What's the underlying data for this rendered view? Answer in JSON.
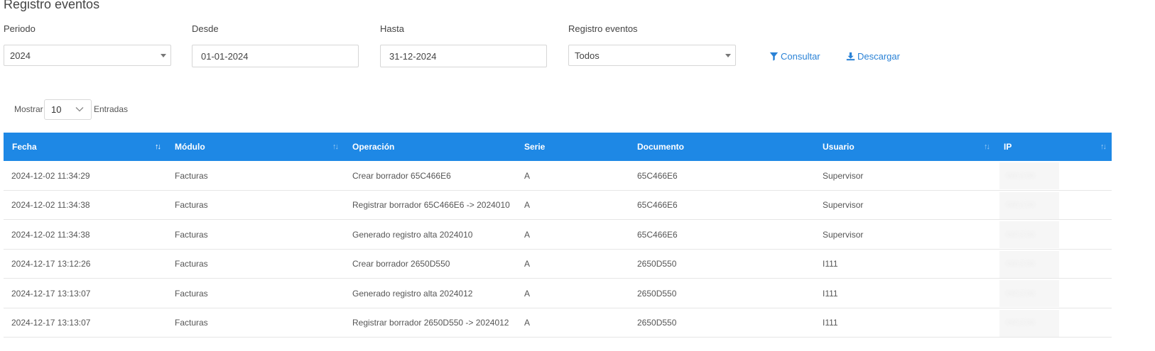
{
  "page": {
    "title": "Registro eventos"
  },
  "filters": {
    "periodo": {
      "label": "Periodo",
      "value": "2024"
    },
    "desde": {
      "label": "Desde",
      "value": "01-01-2024"
    },
    "hasta": {
      "label": "Hasta",
      "value": "31-12-2024"
    },
    "registro": {
      "label": "Registro eventos",
      "value": "Todos"
    }
  },
  "actions": {
    "consultar": {
      "label": "Consultar",
      "icon": "filter-icon"
    },
    "descargar": {
      "label": "Descargar",
      "icon": "download-icon"
    }
  },
  "length_menu": {
    "before": "Mostrar",
    "value": "10",
    "after": "Entradas"
  },
  "colors": {
    "header_bg": "#1e88e5",
    "link": "#2a82d6"
  },
  "table": {
    "columns": [
      "Fecha",
      "Módulo",
      "Operación",
      "Serie",
      "Documento",
      "Usuario",
      "IP"
    ],
    "rows": [
      [
        "2024-12-02 11:34:29",
        "Facturas",
        "Crear borrador 65C466E6",
        "A",
        "65C466E6",
        "Supervisor",
        ""
      ],
      [
        "2024-12-02 11:34:38",
        "Facturas",
        "Registrar borrador 65C466E6 -> 2024010",
        "A",
        "65C466E6",
        "Supervisor",
        ""
      ],
      [
        "2024-12-02 11:34:38",
        "Facturas",
        "Generado registro alta 2024010",
        "A",
        "65C466E6",
        "Supervisor",
        ""
      ],
      [
        "2024-12-17 13:12:26",
        "Facturas",
        "Crear borrador 2650D550",
        "A",
        "2650D550",
        "I111",
        ""
      ],
      [
        "2024-12-17 13:13:07",
        "Facturas",
        "Generado registro alta 2024012",
        "A",
        "2650D550",
        "I111",
        ""
      ],
      [
        "2024-12-17 13:13:07",
        "Facturas",
        "Registrar borrador 2650D550 -> 2024012",
        "A",
        "2650D550",
        "I111",
        ""
      ]
    ]
  }
}
